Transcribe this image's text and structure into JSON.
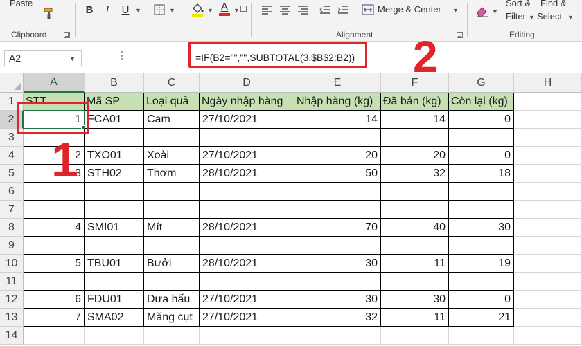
{
  "ribbon": {
    "clipboard": {
      "paste_label": "Paste",
      "group_label": "Clipboard"
    },
    "font": {
      "bold": "B",
      "italic": "I",
      "underline": "U",
      "font_color_glyph": "A"
    },
    "alignment": {
      "merge_center_label": "Merge & Center",
      "group_label": "Alignment"
    },
    "editing": {
      "sort_filter_label_1": "Sort &",
      "sort_filter_label_2": "Filter",
      "find_select_label_1": "Find &",
      "find_select_label_2": "Select",
      "group_label": "Editing"
    }
  },
  "formula_bar": {
    "name_box": "A2",
    "formula": "=IF(B2=\"\",\"\",SUBTOTAL(3,$B$2:B2))"
  },
  "columns": [
    "A",
    "B",
    "C",
    "D",
    "E",
    "F",
    "G",
    "H"
  ],
  "rows": [
    "1",
    "2",
    "3",
    "4",
    "5",
    "6",
    "7",
    "8",
    "9",
    "10",
    "11",
    "12",
    "13",
    "14"
  ],
  "sheet": {
    "header": [
      "STT",
      "Mã SP",
      "Loại quả",
      "Ngày nhập hàng",
      "Nhập hàng (kg)",
      "Đã bán (kg)",
      "Còn lại (kg)"
    ],
    "data_rows": [
      [
        "1",
        "FCA01",
        "Cam",
        "27/10/2021",
        "14",
        "14",
        "0"
      ],
      [
        "",
        "",
        "",
        "",
        "",
        "",
        ""
      ],
      [
        "2",
        "TXO01",
        "Xoài",
        "27/10/2021",
        "20",
        "20",
        "0"
      ],
      [
        "3",
        "STH02",
        "Thơm",
        "28/10/2021",
        "50",
        "32",
        "18"
      ],
      [
        "",
        "",
        "",
        "",
        "",
        "",
        ""
      ],
      [
        "",
        "",
        "",
        "",
        "",
        "",
        ""
      ],
      [
        "4",
        "SMI01",
        "Mít",
        "28/10/2021",
        "70",
        "40",
        "30"
      ],
      [
        "",
        "",
        "",
        "",
        "",
        "",
        ""
      ],
      [
        "5",
        "TBU01",
        "Bưởi",
        "28/10/2021",
        "30",
        "11",
        "19"
      ],
      [
        "",
        "",
        "",
        "",
        "",
        "",
        ""
      ],
      [
        "6",
        "FDU01",
        "Dưa hấu",
        "27/10/2021",
        "30",
        "30",
        "0"
      ],
      [
        "7",
        "SMA02",
        "Măng cụt",
        "27/10/2021",
        "32",
        "11",
        "21"
      ]
    ]
  },
  "annotations": {
    "callout_1": "1",
    "callout_2": "2"
  },
  "colors": {
    "accent_green": "#217346",
    "header_fill": "#c6e0b4",
    "callout_red": "#e0242b"
  }
}
